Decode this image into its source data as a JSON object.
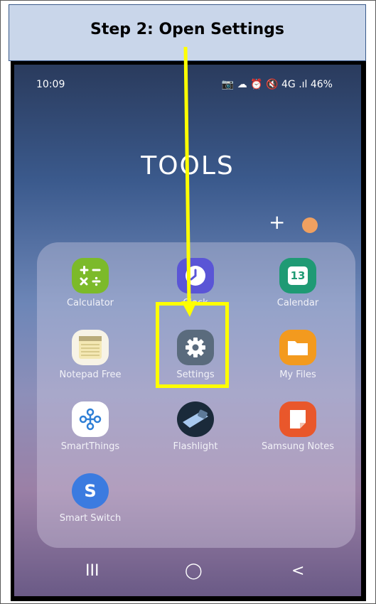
{
  "header": {
    "title": "Step 2: Open Settings"
  },
  "status_bar": {
    "time": "10:09",
    "right_text": "📷 ☁  ⏰ 🔇 4G .ıl 46%"
  },
  "folder": {
    "title": "TOOLS",
    "add_label": "+"
  },
  "apps": [
    {
      "label": "Calculator",
      "icon": "calculator-icon",
      "color": "#7cba2a"
    },
    {
      "label": "Clock",
      "icon": "clock-icon",
      "color": "#5a55d6"
    },
    {
      "label": "Calendar",
      "icon": "calendar-icon",
      "color": "#1f9a74",
      "icon_text": "13"
    },
    {
      "label": "Notepad Free",
      "icon": "notepad-icon",
      "color": "#f5eed6"
    },
    {
      "label": "Settings",
      "icon": "gear-icon",
      "color": "#5a6b7d"
    },
    {
      "label": "My Files",
      "icon": "folder-icon",
      "color": "#f39a1e"
    },
    {
      "label": "SmartThings",
      "icon": "smartthings-icon",
      "color": "#ffffff"
    },
    {
      "label": "Flashlight",
      "icon": "flashlight-icon",
      "color": "#1a2a3a"
    },
    {
      "label": "Samsung Notes",
      "icon": "notes-icon",
      "color": "#e9572b"
    },
    {
      "label": "Smart Switch",
      "icon": "smart-switch-icon",
      "color": "#3b7be0",
      "icon_text": "S"
    }
  ],
  "nav": {
    "recents": "III",
    "home": "◯",
    "back": "<"
  },
  "colors": {
    "highlight": "#ffff00",
    "header_bg": "#c9d6ea"
  }
}
